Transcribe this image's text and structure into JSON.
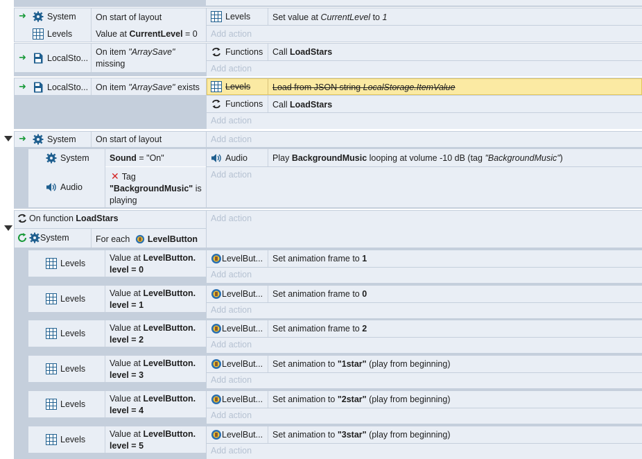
{
  "common": {
    "add_action": "Add action"
  },
  "colors": {
    "block_bg": "#c5cfdc",
    "cell_bg": "#e9eef5",
    "highlight": "#fbeaa3",
    "trigger_arrow": "#1a9a3a",
    "add_action_text": "#b6c2d2"
  },
  "event1": {
    "cond1_object": "System",
    "cond1_text": "On start of layout",
    "cond2_object": "Levels",
    "cond2_prefix": "Value at",
    "cond2_var": "CurrentLevel",
    "cond2_suffix": "= 0",
    "action1_object": "Levels",
    "action1_prefix": "Set value at",
    "action1_var": "CurrentLevel",
    "action1_mid": "to",
    "action1_val": "1"
  },
  "event2": {
    "cond_object": "LocalSto...",
    "cond_prefix": "On item",
    "cond_key": "\"ArraySave\"",
    "cond_suffix": "missing",
    "action_object": "Functions",
    "action_prefix": "Call",
    "action_func": "LoadStars"
  },
  "event3": {
    "cond_object": "LocalSto...",
    "cond_prefix": "On item",
    "cond_key": "\"ArraySave\"",
    "cond_suffix": "exists",
    "action1_object": "Levels",
    "action1_prefix": "Load from JSON string",
    "action1_expr": "LocalStorage.ItemValue",
    "action2_object": "Functions",
    "action2_prefix": "Call",
    "action2_func": "LoadStars"
  },
  "event4": {
    "cond_object": "System",
    "cond_text": "On start of layout",
    "sub": {
      "cond1_object": "System",
      "cond1_var": "Sound",
      "cond1_rest": "= \"On\"",
      "cond2_object": "Audio",
      "cond2_prefix": "Tag",
      "cond2_tag": "\"BackgroundMusic\"",
      "cond2_suffix1": "is",
      "cond2_suffix2": "playing",
      "action_object": "Audio",
      "action_prefix": "Play",
      "action_sound": "BackgroundMusic",
      "action_rest": "looping at volume -10 dB (tag",
      "action_tag": "\"BackgroundMusic\"",
      "action_end": ")"
    }
  },
  "event5": {
    "func_prefix": "On function",
    "func_name": "LoadStars",
    "foreach_object": "System",
    "foreach_prefix": "For each",
    "foreach_target": "LevelButton",
    "subs": [
      {
        "cond_object": "Levels",
        "cond_l1_prefix": "Value at",
        "cond_l1_var": "LevelButton.",
        "cond_l2_var": "level",
        "cond_l2_rest": "= 0",
        "action_object": "LevelBut...",
        "action_prefix": "Set animation frame to",
        "action_value": "1",
        "action_suffix": ""
      },
      {
        "cond_object": "Levels",
        "cond_l1_prefix": "Value at",
        "cond_l1_var": "LevelButton.",
        "cond_l2_var": "level",
        "cond_l2_rest": "= 1",
        "action_object": "LevelBut...",
        "action_prefix": "Set animation frame to",
        "action_value": "0",
        "action_suffix": ""
      },
      {
        "cond_object": "Levels",
        "cond_l1_prefix": "Value at",
        "cond_l1_var": "LevelButton.",
        "cond_l2_var": "level",
        "cond_l2_rest": "= 2",
        "action_object": "LevelBut...",
        "action_prefix": "Set animation frame to",
        "action_value": "2",
        "action_suffix": ""
      },
      {
        "cond_object": "Levels",
        "cond_l1_prefix": "Value at",
        "cond_l1_var": "LevelButton.",
        "cond_l2_var": "level",
        "cond_l2_rest": "= 3",
        "action_object": "LevelBut...",
        "action_prefix": "Set animation to",
        "action_value": "\"1star\"",
        "action_suffix": "(play from beginning)"
      },
      {
        "cond_object": "Levels",
        "cond_l1_prefix": "Value at",
        "cond_l1_var": "LevelButton.",
        "cond_l2_var": "level",
        "cond_l2_rest": "= 4",
        "action_object": "LevelBut...",
        "action_prefix": "Set animation to",
        "action_value": "\"2star\"",
        "action_suffix": "(play from beginning)"
      },
      {
        "cond_object": "Levels",
        "cond_l1_prefix": "Value at",
        "cond_l1_var": "LevelButton.",
        "cond_l2_var": "level",
        "cond_l2_rest": "= 5",
        "action_object": "LevelBut...",
        "action_prefix": "Set animation to",
        "action_value": "\"3star\"",
        "action_suffix": "(play from beginning)"
      }
    ]
  }
}
